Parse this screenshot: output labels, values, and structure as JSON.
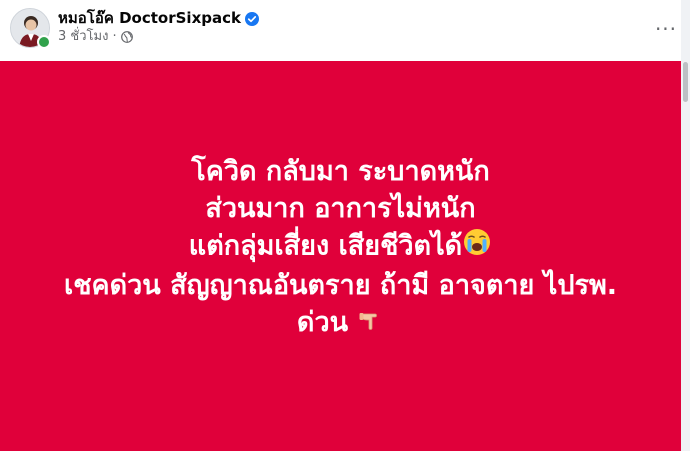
{
  "author": {
    "name": "หมอโอ๊ค DoctorSixpack",
    "verified": true
  },
  "meta": {
    "time": "3 ชั่วโมง",
    "separator": "·",
    "audience_icon": "globe-icon"
  },
  "more_button": {
    "label": "···",
    "icon": "more-horizontal-icon"
  },
  "post": {
    "background_color": "#e0003a",
    "lines": [
      "โควิด กลับมา ระบาดหนัก",
      "ส่วนมาก อาการไม่หนัก",
      "แต่กลุ่มเสี่ยง เสียชีวิตได้",
      "เชคด่วน สัญญาณอันตราย ถ้ามี อาจตาย ไปรพ.",
      "ด่วน"
    ],
    "emojis": {
      "line3": "crying-face-emoji",
      "line5": "pointing-down-emoji"
    }
  },
  "colors": {
    "accent": "#1877f2",
    "online": "#31a24c",
    "text_secondary": "#65676b"
  }
}
